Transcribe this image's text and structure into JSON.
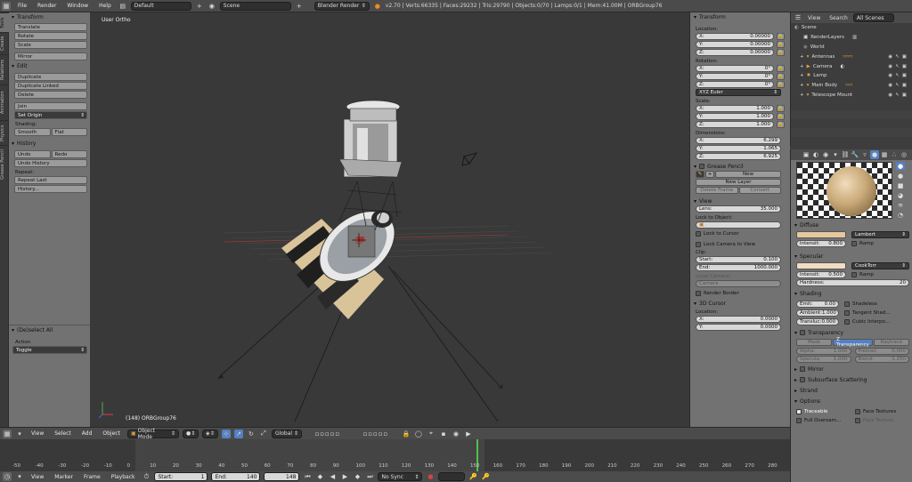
{
  "topbar": {
    "menus": [
      "File",
      "Render",
      "Window",
      "Help"
    ],
    "layout": "Default",
    "scene": "Scene",
    "engine": "Blender Render",
    "stats": "v2.70 | Verts:66335 | Faces:29232 | Tris:29790 | Objects:0/70 | Lamps:0/1 | Mem:41.00M | ORBGroup76"
  },
  "tabs": [
    "Tools",
    "Create",
    "Relations",
    "Animation",
    "Physics",
    "Grease Pencil"
  ],
  "tools": {
    "transform_title": "Transform",
    "transform": [
      "Translate",
      "Rotate",
      "Scale"
    ],
    "mirror": "Mirror",
    "edit_title": "Edit",
    "edit": [
      "Duplicate",
      "Duplicate Linked",
      "Delete"
    ],
    "join": "Join",
    "set_origin": "Set Origin",
    "shading_label": "Shading:",
    "smooth": "Smooth",
    "flat": "Flat",
    "history_title": "History",
    "undo": "Undo",
    "redo": "Redo",
    "undo_history": "Undo History",
    "repeat_label": "Repeat:",
    "repeat_last": "Repeat Last",
    "history": "History...",
    "op_title": "(De)select All",
    "action_label": "Action",
    "action_value": "Toggle"
  },
  "viewport": {
    "view_label": "User Ortho",
    "object_label": "(148) ORBGroup76"
  },
  "npanel": {
    "transform_title": "Transform",
    "location_label": "Location:",
    "location": [
      {
        "k": "X:",
        "v": "0.00000"
      },
      {
        "k": "Y:",
        "v": "0.00000"
      },
      {
        "k": "Z:",
        "v": "0.00000"
      }
    ],
    "rotation_label": "Rotation:",
    "rotation": [
      {
        "k": "X:",
        "v": "0°"
      },
      {
        "k": "Y:",
        "v": "0°"
      },
      {
        "k": "Z:",
        "v": "0°"
      }
    ],
    "euler": "XYZ Euler",
    "scale_label": "Scale:",
    "scale": [
      {
        "k": "X:",
        "v": "1.000"
      },
      {
        "k": "Y:",
        "v": "1.000"
      },
      {
        "k": "Z:",
        "v": "1.000"
      }
    ],
    "dimensions_label": "Dimensions:",
    "dimensions": [
      {
        "k": "X:",
        "v": "6.299"
      },
      {
        "k": "Y:",
        "v": "1.065"
      },
      {
        "k": "Z:",
        "v": "6.925"
      }
    ],
    "grease_title": "Grease Pencil",
    "new": "New",
    "new_layer": "New Layer",
    "delete_frame": "Delete Frame",
    "convert": "Convert",
    "view_title": "View",
    "lens_label": "Lens:",
    "lens_value": "35.000",
    "lock_object": "Lock to Object:",
    "lock_cursor": "Lock to Cursor",
    "lock_camera": "Lock Camera to View",
    "clip_label": "Clip:",
    "clip_start_k": "Start:",
    "clip_start_v": "0.100",
    "clip_end_k": "End:",
    "clip_end_v": "1000.000",
    "local_camera": "Local Camera:",
    "camera": "Camera",
    "render_border": "Render Border",
    "cursor_title": "3D Cursor",
    "cursor_location": "Location:",
    "cursor": [
      {
        "k": "X:",
        "v": "0.0000"
      },
      {
        "k": "Y:",
        "v": "0.0000"
      }
    ]
  },
  "outliner": {
    "tabs": [
      "View",
      "Search",
      "All Scenes"
    ],
    "items": [
      "Scene",
      "RenderLayers",
      "World",
      "Antennas",
      "Camera",
      "Lamp",
      "Main Body",
      "Telescope Mount"
    ]
  },
  "props": {
    "diffuse_title": "Diffuse",
    "diffuse_shader": "Lambert",
    "intensity_k": "Intensit:",
    "diffuse_intensity": "0.800",
    "ramp": "Ramp",
    "specular_title": "Specular",
    "specular_shader": "CookTorr",
    "specular_intensity": "0.500",
    "hardness_k": "Hardness:",
    "hardness": "20",
    "shading_title": "Shading",
    "emit_k": "Emit:",
    "emit": "0.00",
    "ambient_k": "Ambient:",
    "ambient": "1.000",
    "transluc_k": "Transluc:",
    "transluc": "0.000",
    "shadeless": "Shadeless",
    "tangent": "Tangent Shad...",
    "cubic": "Cubic Interpo...",
    "transparency_title": "Transparency",
    "trans_tabs": [
      "Mask",
      "Z Transparency",
      "Raytrace"
    ],
    "alpha_k": "Alpha:",
    "alpha": "1.000",
    "fresnel_k": "Fresnel:",
    "fresnel": "0.000",
    "specula_k": "Specula:",
    "specula": "1.000",
    "blend_k": "Blend:",
    "blend": "1.250",
    "mirror_title": "Mirror",
    "sss_title": "Subsurface Scattering",
    "strand_title": "Strand",
    "options_title": "Options",
    "traceable": "Traceable",
    "face_textures": "Face Textures",
    "full_oversampling": "Full Oversam...",
    "face_textures_alpha": "Face Texture..."
  },
  "vheader": {
    "menus": [
      "View",
      "Select",
      "Add",
      "Object"
    ],
    "mode": "Object Mode",
    "orientation": "Global"
  },
  "timeline": {
    "ticks": [
      "-50",
      "-40",
      "-30",
      "-20",
      "-10",
      "0",
      "10",
      "20",
      "30",
      "40",
      "50",
      "60",
      "70",
      "80",
      "90",
      "100",
      "110",
      "120",
      "130",
      "140",
      "150",
      "160",
      "170",
      "180",
      "190",
      "200",
      "210",
      "220",
      "230",
      "240",
      "250",
      "260",
      "270",
      "280"
    ],
    "frame_current": 148,
    "frame_start": 1,
    "frame_end": 140
  },
  "tlheader": {
    "menus": [
      "View",
      "Marker",
      "Frame",
      "Playback"
    ],
    "start_k": "Start:",
    "start": "1",
    "end_k": "End:",
    "end": "140",
    "current": "148",
    "sync": "No Sync"
  },
  "colors": {
    "diffuse": "#e6c89c",
    "specular": "#f3dcc2",
    "accent_blue": "#5680c2",
    "frame_marker": "#4fc14f"
  }
}
